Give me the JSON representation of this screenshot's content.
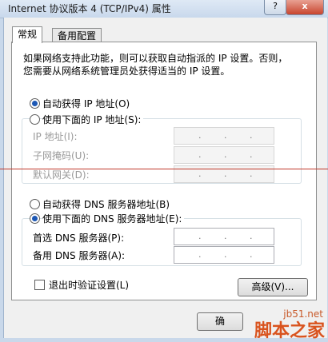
{
  "window": {
    "title": "Internet 协议版本 4 (TCP/IPv4) 属性",
    "help_label": "?",
    "close_label": "x"
  },
  "tabs": [
    {
      "label": "常规"
    },
    {
      "label": "备用配置"
    }
  ],
  "intro_line1": "如果网络支持此功能，则可以获取自动指派的 IP 设置。否则，",
  "intro_line2": "您需要从网络系统管理员处获得适当的 IP 设置。",
  "ip": {
    "auto_label": "自动获得 IP 地址(O)",
    "manual_label": "使用下面的 IP 地址(S):",
    "address_label": "IP 地址(I):",
    "subnet_label": "子网掩码(U):",
    "gateway_label": "默认网关(D):",
    "selected": "auto"
  },
  "dns": {
    "auto_label": "自动获得 DNS 服务器地址(B)",
    "manual_label": "使用下面的 DNS 服务器地址(E):",
    "preferred_label": "首选 DNS 服务器(P):",
    "alternate_label": "备用 DNS 服务器(A):",
    "selected": "manual"
  },
  "ip_dot": ".",
  "validate_label": "退出时验证设置(L)",
  "advanced_label": "高级(V)...",
  "ok_label": "确",
  "watermark": {
    "site": "jb51.net",
    "brand": "脚本之家"
  }
}
